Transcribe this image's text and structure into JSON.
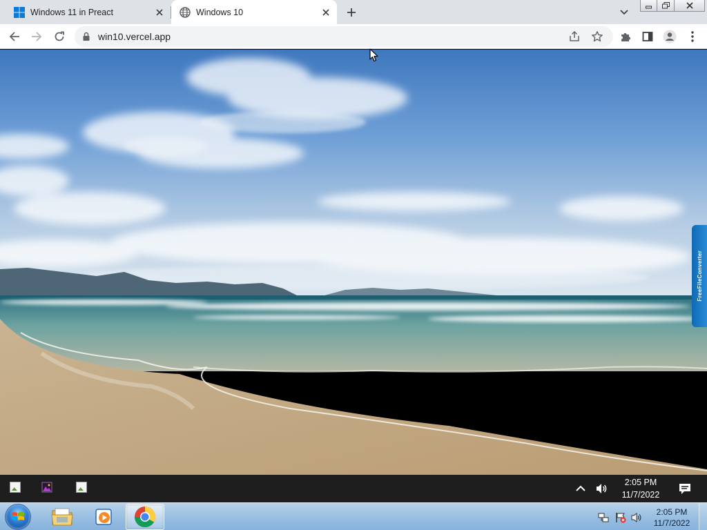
{
  "browser": {
    "tabs": [
      {
        "title": "Windows 11 in Preact",
        "active": false,
        "favicon": "windows-logo-icon"
      },
      {
        "title": "Windows 10",
        "active": true,
        "favicon": "globe-icon"
      }
    ],
    "url": "win10.vercel.app",
    "toolbar_icons": [
      "back-icon",
      "forward-icon",
      "reload-icon",
      "lock-icon",
      "share-icon",
      "star-icon",
      "extensions-icon",
      "side-panel-icon",
      "profile-icon",
      "menu-icon"
    ]
  },
  "page": {
    "wallpaper": "beach-wallpaper",
    "side_widget_label": "FreeFileConverter"
  },
  "web_taskbar": {
    "pinned_icons": [
      "broken-image-icon",
      "photos-icon",
      "broken-image-icon"
    ],
    "tray_icons": [
      "chevron-up-icon",
      "volume-icon",
      "notifications-icon"
    ],
    "time": "2:05 PM",
    "date": "11/7/2022"
  },
  "host_taskbar": {
    "apps": [
      {
        "name": "windows-explorer",
        "active": false
      },
      {
        "name": "media-player",
        "active": false
      },
      {
        "name": "google-chrome",
        "active": true
      }
    ],
    "tray_icons": [
      "network-icon",
      "action-center-flag-icon",
      "volume-icon"
    ],
    "time": "2:05 PM",
    "date": "11/7/2022"
  },
  "colors": {
    "tabstrip": "#dee1e6",
    "web_taskbar": "#1e1e1e",
    "host_taskbar": "#9cc1e3"
  }
}
